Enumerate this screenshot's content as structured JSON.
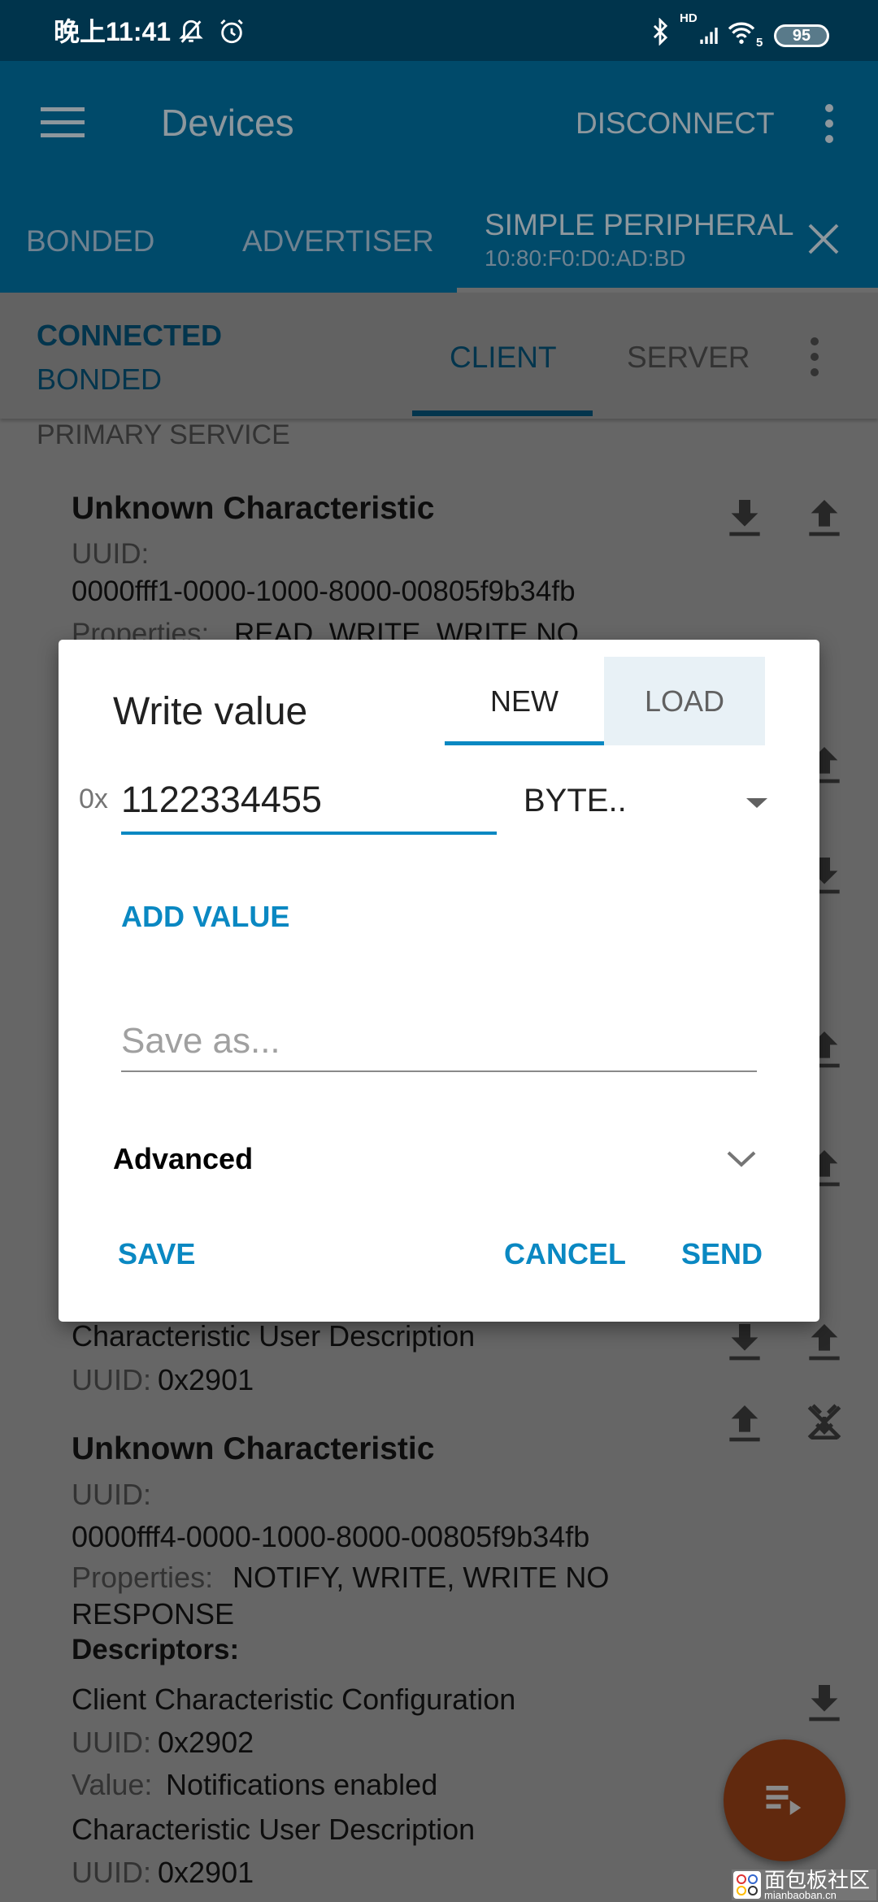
{
  "status_bar": {
    "time": "晚上11:41",
    "battery": "95",
    "network": "HD",
    "wifi_level": "5"
  },
  "app_bar": {
    "title": "Devices",
    "disconnect": "DISCONNECT"
  },
  "device_tabs": [
    {
      "label": "BONDED"
    },
    {
      "label": "ADVERTISER"
    },
    {
      "label": "SIMPLE PERIPHERAL",
      "sub": "10:80:F0:D0:AD:BD",
      "active": true
    }
  ],
  "connection": {
    "state": "CONNECTED",
    "bond": "BONDED"
  },
  "mode_tabs": [
    {
      "label": "CLIENT",
      "active": true
    },
    {
      "label": "SERVER"
    }
  ],
  "service": {
    "label": "PRIMARY SERVICE"
  },
  "characteristics": [
    {
      "name": "Unknown Characteristic",
      "uuid_label": "UUID:",
      "uuid": "0000fff1-0000-1000-8000-00805f9b34fb",
      "properties_label": "Properties:",
      "properties": "READ, WRITE, WRITE NO"
    },
    {
      "desc_name": "Characteristic User Description",
      "uuid_label": "UUID:",
      "uuid": "0x2901"
    },
    {
      "name": "Unknown Characteristic",
      "uuid_label": "UUID:",
      "uuid": "0000fff4-0000-1000-8000-00805f9b34fb",
      "properties_label": "Properties:",
      "properties": "NOTIFY, WRITE, WRITE NO",
      "properties_2": "RESPONSE",
      "descriptors_label": "Descriptors:",
      "descriptors": [
        {
          "name": "Client Characteristic Configuration",
          "uuid_label": "UUID:",
          "uuid": "0x2902",
          "value_label": "Value:",
          "value": "Notifications enabled"
        },
        {
          "name": "Characteristic User Description",
          "uuid_label": "UUID:",
          "uuid": "0x2901"
        }
      ]
    }
  ],
  "dialog": {
    "title": "Write value",
    "tabs": [
      {
        "label": "NEW",
        "active": true
      },
      {
        "label": "LOAD"
      }
    ],
    "prefix": "0x",
    "value": "1122334455",
    "type": "BYTE..",
    "add_value": "ADD VALUE",
    "save_as_placeholder": "Save as...",
    "advanced": "Advanced",
    "save": "SAVE",
    "cancel": "CANCEL",
    "send": "SEND"
  },
  "watermark": {
    "text": "面包板社区",
    "sub": "mianbaoban.cn"
  },
  "colors": {
    "accent": "#0a88c2",
    "appbar": "#0a8fcc",
    "fab": "#f26722"
  }
}
